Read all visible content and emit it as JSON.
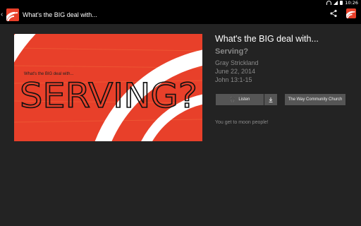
{
  "status_bar": {
    "time": "10:26",
    "icons": [
      "wifi-icon",
      "signal-icon",
      "battery-icon"
    ]
  },
  "action_bar": {
    "title": "What's the BIG deal with...",
    "icons": [
      "back-arrow-icon",
      "app-logo-icon",
      "share-icon",
      "app-logo-icon"
    ]
  },
  "artwork": {
    "top_text": "What's the BIG deal with...",
    "main_text": "SERVING?",
    "accent_color": "#e8402a"
  },
  "sermon": {
    "series_title": "What's the BIG deal with...",
    "title": "Serving?",
    "speaker": "Gray Strickland",
    "date": "June 22, 2014",
    "passage": "John 13:1-15"
  },
  "buttons": {
    "listen_label": "Listen",
    "church_label": "The Way Community Church"
  },
  "description": "You get to moon people!",
  "colors": {
    "background": "#232323",
    "bar": "#000000",
    "button": "#555555",
    "muted_text": "#8a8a8a"
  }
}
